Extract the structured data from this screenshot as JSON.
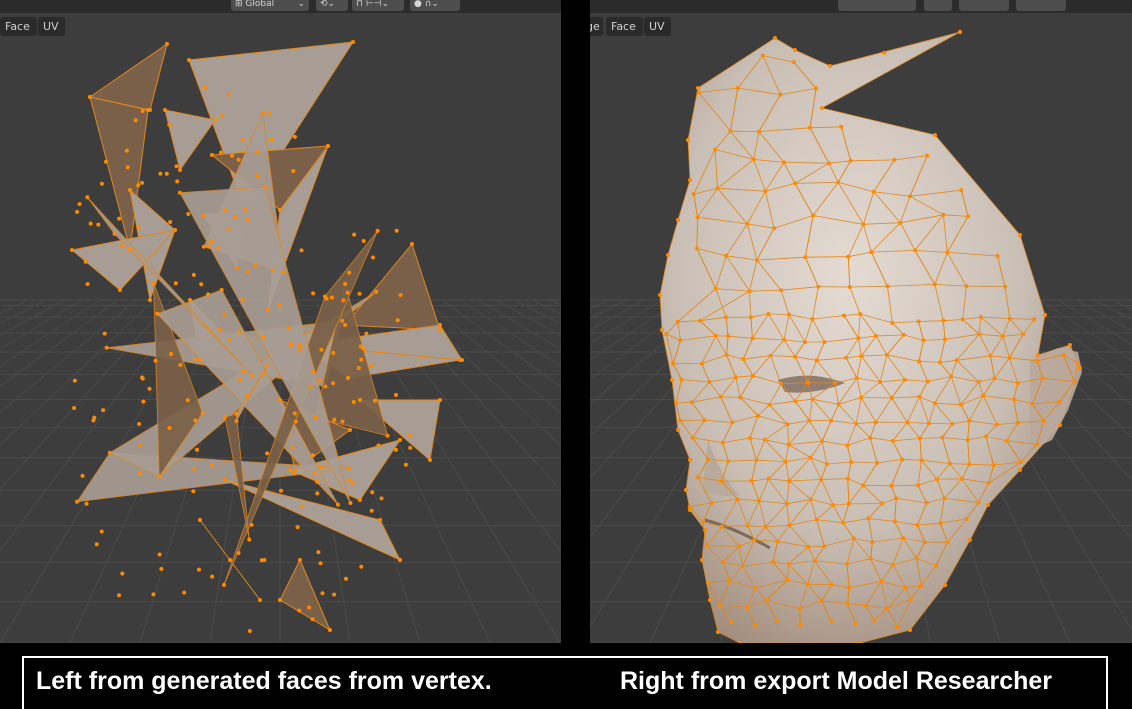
{
  "left_viewport": {
    "menu": [
      {
        "label": "Face"
      },
      {
        "label": "UV"
      }
    ],
    "header": {
      "orientation_value": "Global",
      "orientation_chevron": "⌄",
      "snap_icon": "magnet-icon",
      "proportional_icon": "proportional-editing-icon"
    }
  },
  "right_viewport": {
    "menu": [
      {
        "label": "ge"
      },
      {
        "label": "Face"
      },
      {
        "label": "UV"
      }
    ]
  },
  "caption": {
    "left": "Left from generated faces from vertex.",
    "right": "Right from export Model Researcher"
  },
  "colors": {
    "viewport_bg": "#3d3d3d",
    "grid_line": "#4a4a4a",
    "mesh_face": "#a89d94",
    "mesh_face_dark": "#7a6048",
    "mesh_edge": "#e0871c",
    "vertex": "#ff8a00",
    "head_skin": "#d2c7bd",
    "caption_text": "#ffffff"
  }
}
